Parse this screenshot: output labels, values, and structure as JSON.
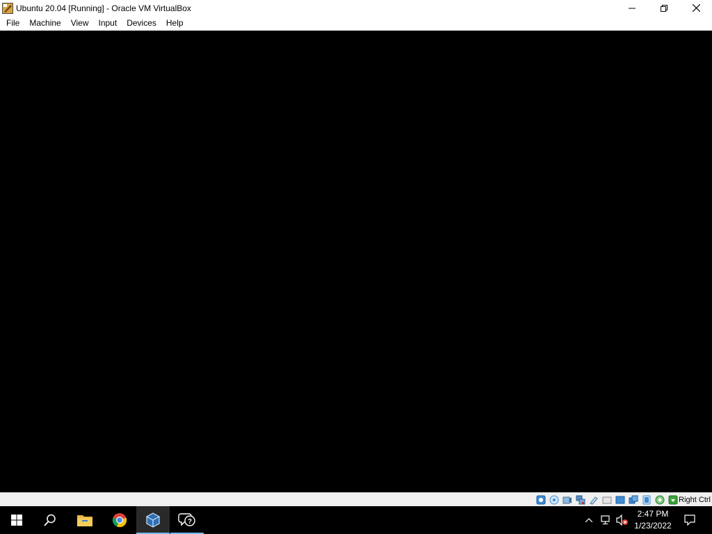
{
  "window": {
    "title": "Ubuntu 20.04 [Running] - Oracle VM VirtualBox"
  },
  "menu": {
    "items": [
      "File",
      "Machine",
      "View",
      "Input",
      "Devices",
      "Help"
    ]
  },
  "statusbar": {
    "host_key": "Right Ctrl",
    "icons": [
      "hard-disk-icon",
      "optical-drive-icon",
      "audio-icon",
      "network-icon",
      "usb-icon",
      "shared-folders-icon",
      "display-icon",
      "video-capture-icon",
      "virtualization-icon",
      "cpu-icon",
      "mouse-integration-icon",
      "keyboard-capture-icon"
    ]
  },
  "taskbar": {
    "apps": [
      "start-icon",
      "search-icon",
      "file-explorer-icon",
      "chrome-icon",
      "virtualbox-icon",
      "feedback-hub-icon"
    ],
    "clock": {
      "time": "2:47 PM",
      "date": "1/23/2022"
    }
  },
  "colors": {
    "taskbar_bg": "#000000",
    "active_indicator": "#76b9ed",
    "statusbar_bg": "#f0f0f0"
  }
}
